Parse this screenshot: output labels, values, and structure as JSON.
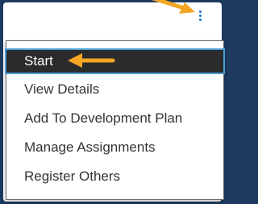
{
  "menu": {
    "items": [
      {
        "label": "Start",
        "selected": true
      },
      {
        "label": "View Details"
      },
      {
        "label": "Add To Development Plan"
      },
      {
        "label": "Manage Assignments"
      },
      {
        "label": "Register Others"
      }
    ]
  },
  "colors": {
    "background": "#1e3a5f",
    "annotation_arrow": "#f5a623",
    "kebab_icon": "#1a73c7",
    "selected_row": "#2b2b2b",
    "selected_outline": "#4a9fd6"
  },
  "icons": {
    "options_menu": "kebab-vertical-dots-icon",
    "annotation": "arrow-icon"
  }
}
